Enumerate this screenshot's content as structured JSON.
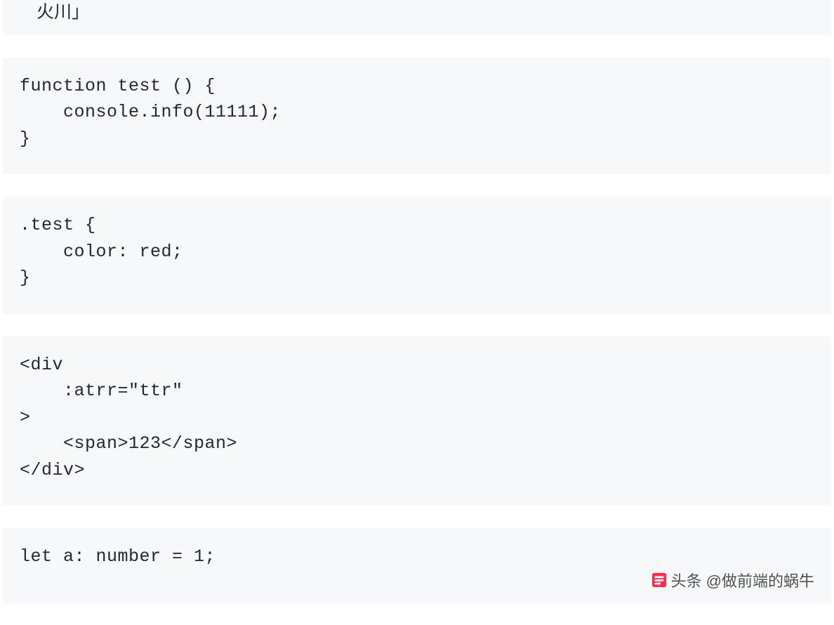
{
  "fragment_top": "火川」",
  "blocks": {
    "js": "function test () {\n    console.info(11111);\n}",
    "css": ".test {\n    color: red;\n}",
    "html": "<div\n    :atrr=\"ttr\"\n>\n    <span>123</span>\n</div>",
    "ts": "let a: number = 1;"
  },
  "watermark": {
    "prefix": "头条",
    "author": "@做前端的蜗牛"
  }
}
